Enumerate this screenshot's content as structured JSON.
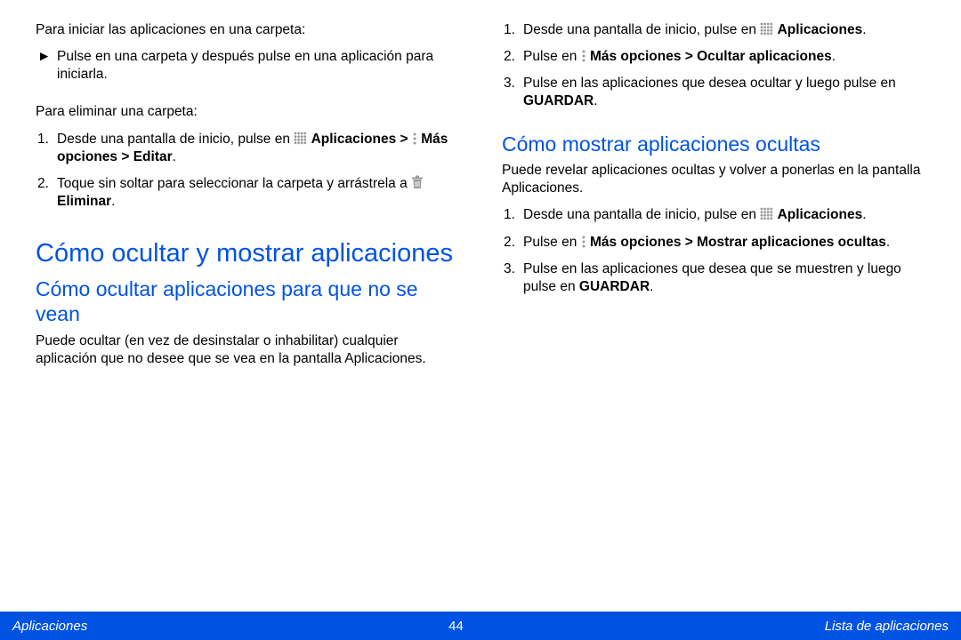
{
  "left": {
    "intro_folder_launch": "Para iniciar las aplicaciones en una carpeta:",
    "bullet1": "Pulse en una carpeta y después pulse en una aplicación para iniciarla.",
    "intro_folder_delete": "Para eliminar una carpeta:",
    "step1_a": "Desde una pantalla de inicio, pulse en ",
    "step1_b": "Aplicaciones > ",
    "step1_c": " Más opciones > Editar",
    "step2_a": "Toque sin soltar para seleccionar la carpeta y arrástrela a ",
    "step2_b": " Eliminar",
    "h1": "Cómo ocultar y mostrar aplicaciones",
    "h2": "Cómo ocultar aplicaciones para que no se vean",
    "body": "Puede ocultar (en vez de desinstalar o inhabilitar) cualquier aplicación que no desee que se vea en la pantalla Aplicaciones."
  },
  "right": {
    "hide_step1_a": "Desde una pantalla de inicio, pulse en ",
    "hide_step1_b": "Aplicaciones",
    "hide_step2_a": "Pulse en ",
    "hide_step2_b": " Más opciones > Ocultar aplicaciones",
    "hide_step3_a": "Pulse en las aplicaciones que desea ocultar y luego pulse en ",
    "hide_step3_b": "GUARDAR",
    "h2": "Cómo mostrar aplicaciones ocultas",
    "body": "Puede revelar aplicaciones ocultas y volver a ponerlas en la pantalla Aplicaciones.",
    "show_step1_a": "Desde una pantalla de inicio, pulse en ",
    "show_step1_b": "Aplicaciones",
    "show_step2_a": "Pulse en ",
    "show_step2_b": " Más opciones > Mostrar aplicaciones ocultas",
    "show_step3_a": "Pulse en las aplicaciones que desea que se muestren y luego pulse en ",
    "show_step3_b": "GUARDAR"
  },
  "footer": {
    "left": "Aplicaciones",
    "page": "44",
    "right": "Lista de aplicaciones"
  },
  "markers": {
    "arrow": "►",
    "n1": "1.",
    "n2": "2.",
    "n3": "3.",
    "period": "."
  }
}
